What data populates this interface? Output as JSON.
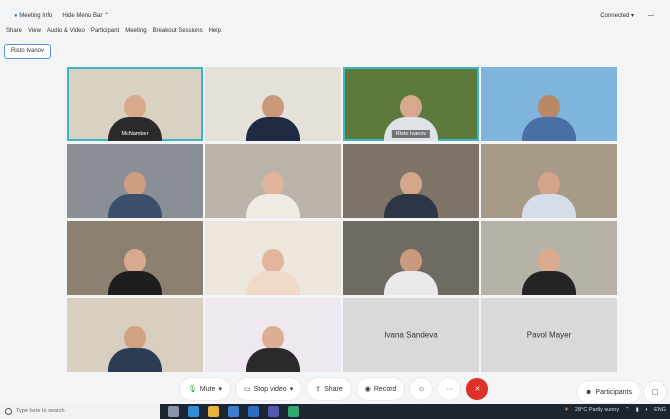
{
  "topbar": {
    "meeting_info": "Meeting Info",
    "hide_menu": "Hide Menu Bar",
    "connection": "Connected"
  },
  "menu": [
    "Share",
    "View",
    "Audio & Video",
    "Participant",
    "Meeting",
    "Breakout Sessions",
    "Help"
  ],
  "speaker_chip": "Risto Ivanov",
  "tiles": [
    {
      "name": "McNamber",
      "active": true,
      "bg": "#d9d2c3",
      "skin": "#d8a98a",
      "shirt": "#2b2b2b"
    },
    {
      "name": "",
      "bg": "#e4e1db",
      "skin": "#c99979",
      "shirt": "#1f2a44"
    },
    {
      "name": "Risto Ivanov",
      "active": true,
      "bg": "#5c7a3b",
      "skin": "#d7a88b",
      "shirt": "#dfe3e8"
    },
    {
      "name": "",
      "bg": "#7fb4dc",
      "skin": "#b88867",
      "shirt": "#4a6fa5"
    },
    {
      "name": "",
      "bg": "#8a8f95",
      "skin": "#cf9e80",
      "shirt": "#3c4f6b"
    },
    {
      "name": "",
      "bg": "#b9b3aa",
      "skin": "#e0b49a",
      "shirt": "#efeae4"
    },
    {
      "name": "",
      "bg": "#7d7366",
      "skin": "#d6a68a",
      "shirt": "#2c3646"
    },
    {
      "name": "",
      "bg": "#a79a86",
      "skin": "#d5a58b",
      "shirt": "#d5dde8"
    },
    {
      "name": "",
      "bg": "#8c8070",
      "skin": "#d9a98f",
      "shirt": "#1e1e1e"
    },
    {
      "name": "",
      "bg": "#ede6dc",
      "skin": "#e3b69c",
      "shirt": "#f0d9c8"
    },
    {
      "name": "",
      "bg": "#6f6a62",
      "skin": "#c99a7d",
      "shirt": "#e9e9e9"
    },
    {
      "name": "",
      "bg": "#b7b2a8",
      "skin": "#d9aa8e",
      "shirt": "#242424"
    },
    {
      "name": "",
      "bg": "#d8cfc0",
      "skin": "#d2a184",
      "shirt": "#2d3c55"
    },
    {
      "name": "",
      "bg": "#efe8f0",
      "skin": "#dcae93",
      "shirt": "#2a2a2a"
    },
    {
      "name": "Ivana Sandeva",
      "blank": true
    },
    {
      "name": "Pavol Mayer",
      "blank": true
    }
  ],
  "controls": {
    "mute": "Mute",
    "stop_video": "Stop video",
    "share": "Share",
    "record": "Record",
    "participants": "Participants"
  },
  "taskbar": {
    "search_placeholder": "Type here to search",
    "weather": "28°C  Partly sunny",
    "lang": "ENG"
  },
  "colors": {
    "accent": "#3bb6c4",
    "leave": "#e0302a",
    "taskbar": "#1d2432"
  }
}
